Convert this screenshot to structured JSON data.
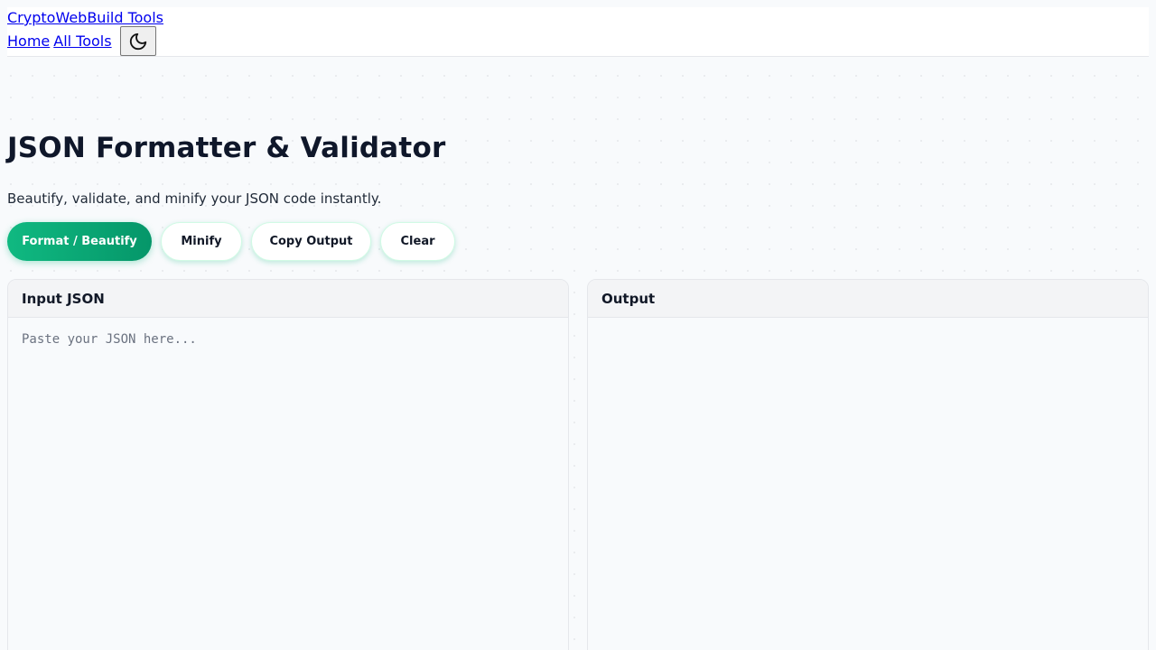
{
  "header": {
    "brand": "CryptoWebBuild Tools",
    "nav": [
      "Home",
      "All Tools"
    ],
    "theme_toggle_icon": "moon-icon"
  },
  "page": {
    "title": "JSON Formatter & Validator",
    "subtitle": "Beautify, validate, and minify your JSON code instantly."
  },
  "toolbar": {
    "format_label": "Format / Beautify",
    "minify_label": "Minify",
    "copy_label": "Copy Output",
    "clear_label": "Clear"
  },
  "input_panel": {
    "title": "Input JSON",
    "value": "",
    "placeholder": "Paste your JSON here..."
  },
  "output_panel": {
    "title": "Output",
    "value": ""
  },
  "colors": {
    "accent": "#10b981",
    "accent_dark": "#059669",
    "background": "#f8fafc",
    "link": "#0000ee"
  }
}
